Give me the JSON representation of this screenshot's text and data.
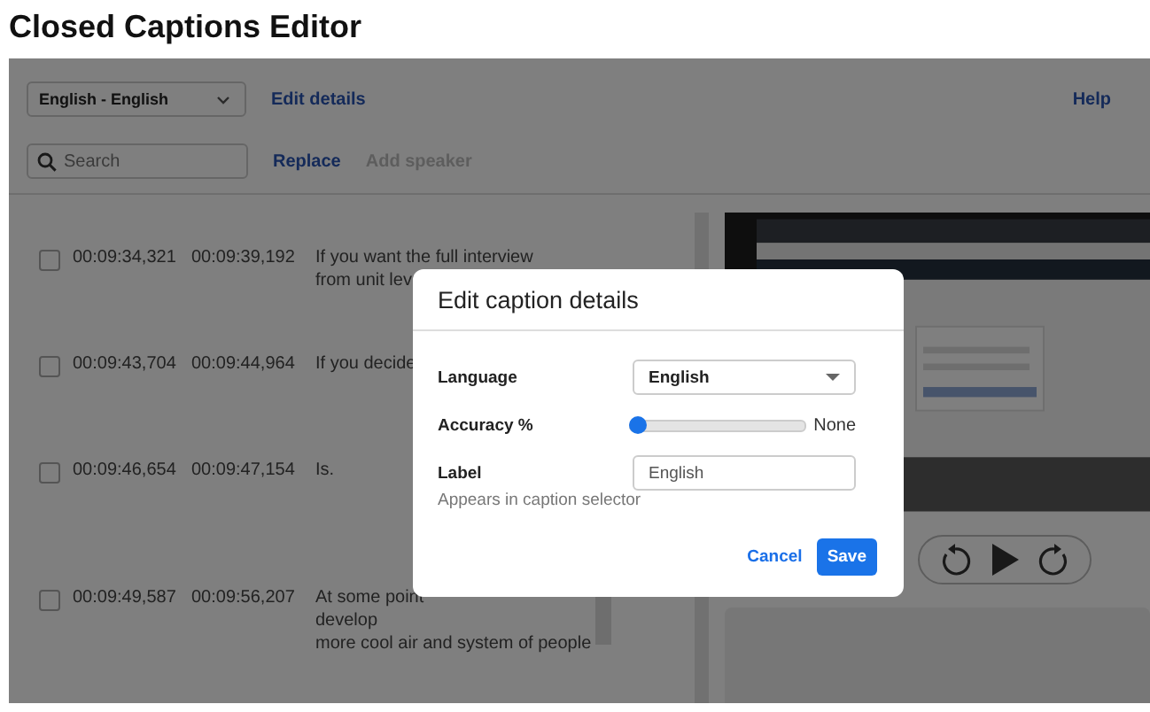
{
  "page_title": "Closed Captions Editor",
  "toolbar": {
    "language_select": "English - English",
    "edit_link": "Edit details",
    "help_link": "Help"
  },
  "search": {
    "placeholder": "Search"
  },
  "actions": [
    {
      "label": "Replace",
      "disabled": false
    },
    {
      "label": "Add speaker",
      "disabled": true
    }
  ],
  "captions": [
    {
      "checked": false,
      "start": "00:09:34,321",
      "end": "00:09:39,192",
      "lines": [
        "If you want the full interview",
        "from unit lev"
      ]
    },
    {
      "checked": false,
      "start": "00:09:43,704",
      "end": "00:09:44,964",
      "lines": [
        "If you decide"
      ]
    },
    {
      "checked": false,
      "start": "00:09:46,654",
      "end": "00:09:47,154",
      "lines": [
        "Is."
      ]
    },
    {
      "checked": false,
      "start": "00:09:49,587",
      "end": "00:09:56,207",
      "lines": [
        "At some point",
        "develop",
        "more cool air and system of people"
      ]
    }
  ],
  "dialog": {
    "title": "Edit caption details",
    "fields": [
      {
        "kind": "select",
        "label": "Language",
        "value": "English"
      },
      {
        "kind": "slider",
        "label": "Accuracy %",
        "level": 0,
        "reading": "None"
      },
      {
        "kind": "text",
        "label": "Label",
        "value": "English",
        "hint": "Appears in caption selector"
      }
    ],
    "buttons": [
      {
        "label": "Cancel",
        "kind": "link"
      },
      {
        "label": "Save",
        "kind": "primary"
      }
    ]
  }
}
